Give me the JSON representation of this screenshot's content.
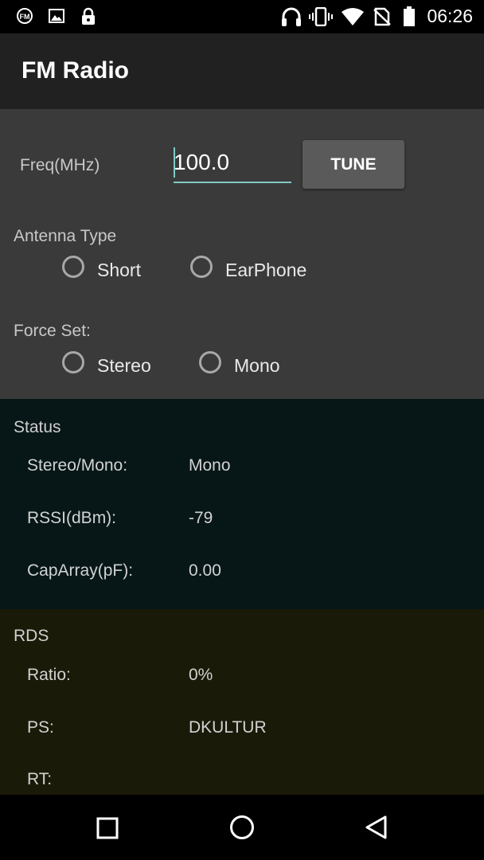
{
  "status_bar": {
    "time": "06:26",
    "icons": [
      "fm-radio-icon",
      "image-icon",
      "lock-icon",
      "headset-icon",
      "vibrate-icon",
      "wifi-icon",
      "no-sim-icon",
      "battery-icon"
    ]
  },
  "toolbar": {
    "title": "FM Radio"
  },
  "freq": {
    "label": "Freq(MHz)",
    "value": "100.0",
    "tune_label": "TUNE"
  },
  "antenna": {
    "title": "Antenna Type",
    "options": [
      "Short",
      "EarPhone"
    ]
  },
  "force_set": {
    "title": "Force Set:",
    "options": [
      "Stereo",
      "Mono"
    ]
  },
  "status": {
    "title": "Status",
    "rows": [
      {
        "label": "Stereo/Mono:",
        "value": "Mono"
      },
      {
        "label": "RSSI(dBm):",
        "value": "-79"
      },
      {
        "label": "CapArray(pF):",
        "value": "0.00"
      }
    ]
  },
  "rds": {
    "title": "RDS",
    "rows": [
      {
        "label": "Ratio:",
        "value": "0%"
      },
      {
        "label": "PS:",
        "value": "DKULTUR"
      },
      {
        "label": "RT:",
        "value": ""
      }
    ]
  },
  "colors": {
    "accent": "#80cbc4",
    "status_bg": "#071718",
    "rds_bg": "#1a1a08",
    "panel_bg": "#3a3a3a",
    "toolbar_bg": "#212121"
  }
}
